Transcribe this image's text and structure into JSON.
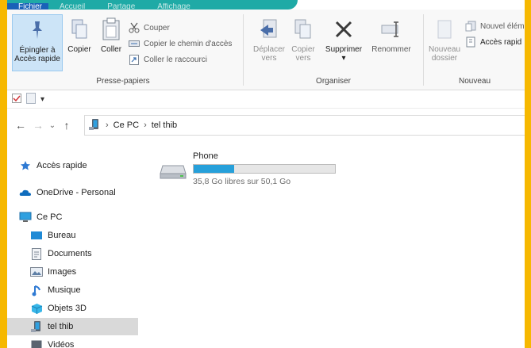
{
  "tabs": [
    {
      "label": "Fichier"
    },
    {
      "label": "Accueil"
    },
    {
      "label": "Partage"
    },
    {
      "label": "Affichage"
    }
  ],
  "ribbon": {
    "pin_label_1": "Épingler à",
    "pin_label_2": "Accès rapide",
    "copy_label": "Copier",
    "paste_label": "Coller",
    "cut_label": "Couper",
    "copy_path_label": "Copier le chemin d'accès",
    "paste_shortcut_label": "Coller le raccourci",
    "clipboard_group": "Presse-papiers",
    "move_label_1": "Déplacer",
    "move_label_2": "vers",
    "copyto_label_1": "Copier",
    "copyto_label_2": "vers",
    "delete_label": "Supprimer",
    "rename_label": "Renommer",
    "organize_group": "Organiser",
    "new_folder_label_1": "Nouveau",
    "new_folder_label_2": "dossier",
    "new_item_label": "Nouvel élém",
    "quick_access_label": "Accès rapid",
    "new_group": "Nouveau"
  },
  "address": {
    "crumbs": [
      "Ce PC",
      "tel thib"
    ]
  },
  "nav": {
    "quick_access": "Accès rapide",
    "onedrive": "OneDrive - Personal",
    "this_pc": "Ce PC",
    "desktop": "Bureau",
    "documents": "Documents",
    "images": "Images",
    "music": "Musique",
    "objects3d": "Objets 3D",
    "device": "tel thib",
    "videos": "Vidéos"
  },
  "drive": {
    "name": "Phone",
    "free_text": "35,8 Go libres sur 50,1 Go",
    "used_fraction": 0.285
  },
  "colors": {
    "accent": "#26a0da",
    "frame_border": "#f6b800",
    "tab_strip": "#1faaa6"
  }
}
